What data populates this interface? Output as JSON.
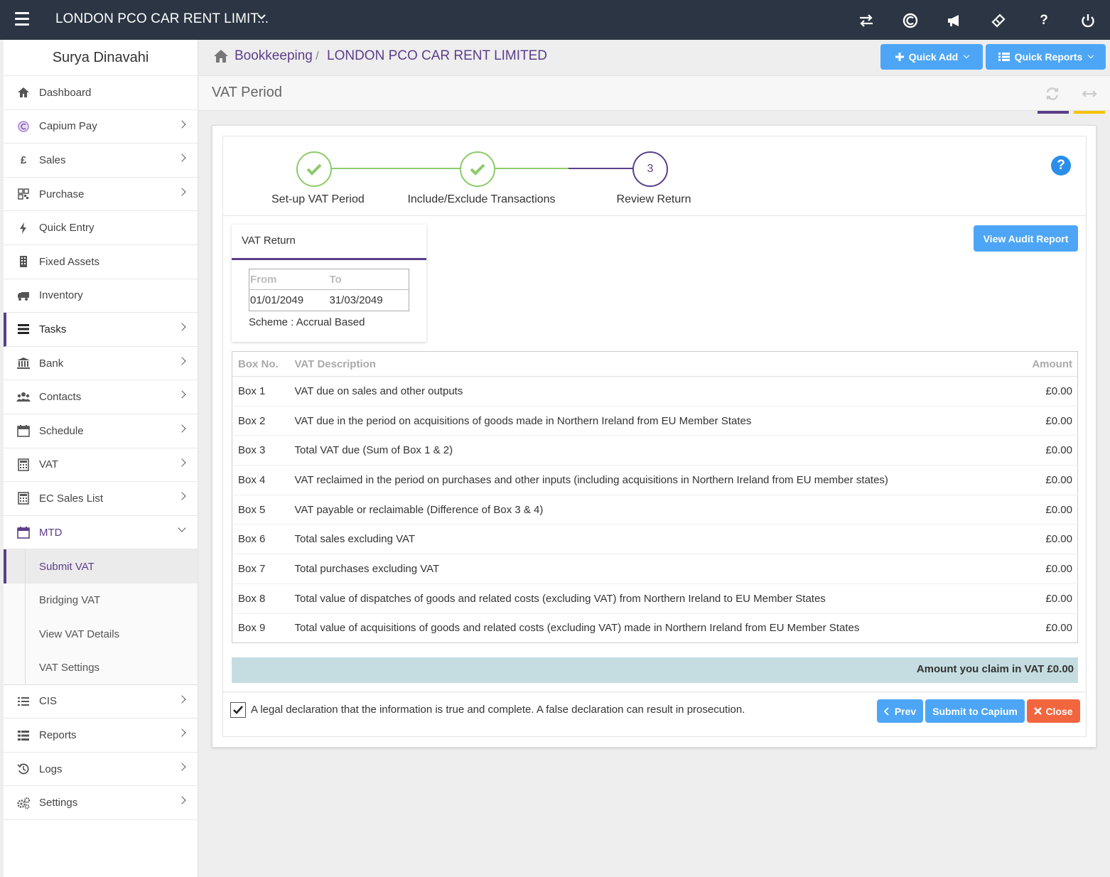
{
  "topbar": {
    "company": "LONDON PCO CAR RENT LIMIT...",
    "company_chevron": "chevron-down-icon",
    "icons": [
      "swap-icon",
      "capium-icon",
      "megaphone-icon",
      "ticket-icon",
      "help-icon",
      "power-icon"
    ]
  },
  "sidebar": {
    "user": "Surya Dinavahi",
    "items": [
      {
        "label": "Dashboard",
        "icon": "home-icon"
      },
      {
        "label": "Capium Pay",
        "icon": "capium-icon"
      },
      {
        "label": "Sales",
        "icon": "pound-icon"
      },
      {
        "label": "Purchase",
        "icon": "qrcode-icon"
      },
      {
        "label": "Quick Entry",
        "icon": "bolt-icon"
      },
      {
        "label": "Fixed Assets",
        "icon": "building-icon"
      },
      {
        "label": "Inventory",
        "icon": "truck-icon"
      },
      {
        "label": "Tasks",
        "icon": "tasks-icon"
      },
      {
        "label": "Bank",
        "icon": "bank-icon"
      },
      {
        "label": "Contacts",
        "icon": "users-icon"
      },
      {
        "label": "Schedule",
        "icon": "calendar-icon"
      },
      {
        "label": "VAT",
        "icon": "calculator-icon"
      },
      {
        "label": "EC Sales List",
        "icon": "calculator-icon"
      },
      {
        "label": "MTD",
        "icon": "calendar-icon"
      }
    ],
    "mtd_sub": [
      "Submit VAT",
      "Bridging VAT",
      "View VAT Details",
      "VAT Settings"
    ],
    "items_after": [
      {
        "label": "CIS",
        "icon": "list-icon"
      },
      {
        "label": "Reports",
        "icon": "list-icon"
      },
      {
        "label": "Logs",
        "icon": "history-icon"
      },
      {
        "label": "Settings",
        "icon": "cogs-icon"
      }
    ]
  },
  "breadcrumb": {
    "root": "Bookkeeping",
    "separator": "/",
    "current": "LONDON PCO CAR RENT LIMITED"
  },
  "header_buttons": {
    "quick_add": "Quick Add",
    "quick_reports": "Quick Reports"
  },
  "page": {
    "title": "VAT Period"
  },
  "stepper": {
    "steps": [
      {
        "label": "Set-up VAT Period",
        "state": "done"
      },
      {
        "label": "Include/Exclude Transactions",
        "state": "done"
      },
      {
        "label": "Review Return",
        "state": "current",
        "number": "3"
      }
    ]
  },
  "vat_return": {
    "title": "VAT Return",
    "from_label": "From",
    "to_label": "To",
    "from": "01/01/2049",
    "to": "31/03/2049",
    "scheme": "Scheme : Accrual Based"
  },
  "audit_button": "View Audit Report",
  "table": {
    "headers": {
      "box": "Box No.",
      "desc": "VAT Description",
      "amount": "Amount"
    },
    "rows": [
      {
        "box": "Box 1",
        "desc": "VAT due on sales and other outputs",
        "amount": "£0.00"
      },
      {
        "box": "Box 2",
        "desc": "VAT due in the period on acquisitions of goods made in Northern Ireland from EU Member States",
        "amount": "£0.00"
      },
      {
        "box": "Box 3",
        "desc": "Total VAT due (Sum of Box 1 & 2)",
        "amount": "£0.00"
      },
      {
        "box": "Box 4",
        "desc": "VAT reclaimed in the period on purchases and other inputs (including acquisitions in Northern Ireland from EU member states)",
        "amount": "£0.00"
      },
      {
        "box": "Box 5",
        "desc": "VAT payable or reclaimable (Difference of Box 3 & 4)",
        "amount": "£0.00"
      },
      {
        "box": "Box 6",
        "desc": "Total sales excluding VAT",
        "amount": "£0.00"
      },
      {
        "box": "Box 7",
        "desc": "Total purchases excluding VAT",
        "amount": "£0.00"
      },
      {
        "box": "Box 8",
        "desc": "Total value of dispatches of goods and related costs (excluding VAT) from Northern Ireland to EU Member States",
        "amount": "£0.00"
      },
      {
        "box": "Box 9",
        "desc": "Total value of acquisitions of goods and related costs (excluding VAT) made in Northern Ireland from EU Member States",
        "amount": "£0.00"
      }
    ]
  },
  "claim": "Amount you claim in VAT £0.00",
  "declaration": {
    "checked": true,
    "text": "A legal declaration that the information is true and complete. A false declaration can result in prosecution."
  },
  "footer_buttons": {
    "prev": "Prev",
    "submit": "Submit to Capium",
    "close": "Close"
  },
  "colors": {
    "topbar": "#2b3543",
    "accent_purple": "#5b3e8a",
    "button_blue": "#4da6f5",
    "close_orange": "#f2663f",
    "step_done_green": "#8ccb6a",
    "claim_bar": "#c5dde1"
  }
}
